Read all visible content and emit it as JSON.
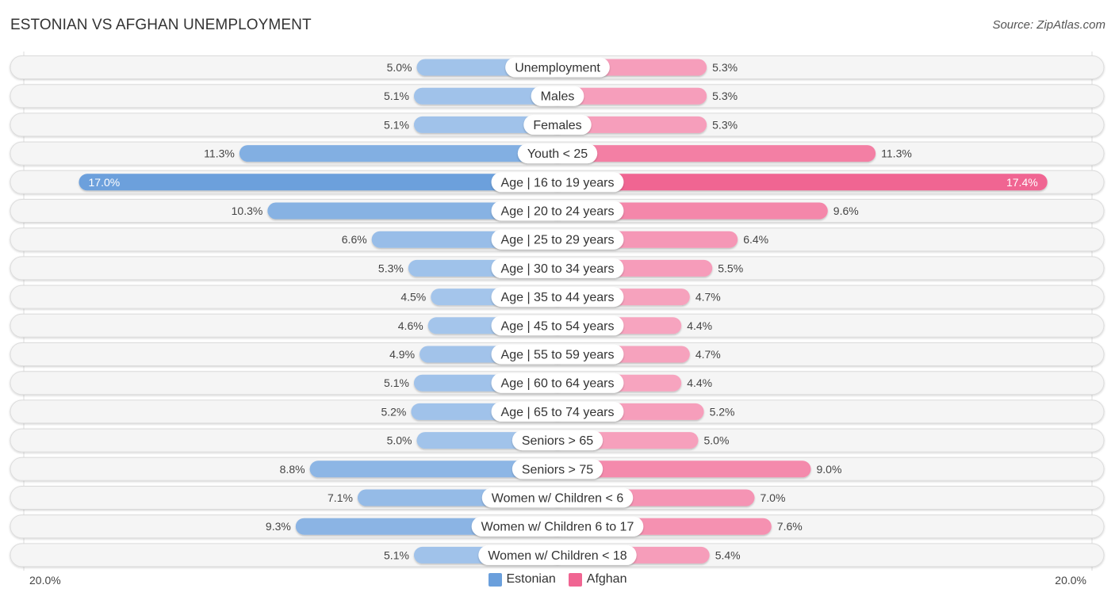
{
  "header": {
    "title": "ESTONIAN VS AFGHAN UNEMPLOYMENT",
    "source": "Source: ZipAtlas.com"
  },
  "chart_data": {
    "type": "bar",
    "orientation": "horizontal-diverging",
    "title": "ESTONIAN VS AFGHAN UNEMPLOYMENT",
    "categories": [
      "Unemployment",
      "Males",
      "Females",
      "Youth < 25",
      "Age | 16 to 19 years",
      "Age | 20 to 24 years",
      "Age | 25 to 29 years",
      "Age | 30 to 34 years",
      "Age | 35 to 44 years",
      "Age | 45 to 54 years",
      "Age | 55 to 59 years",
      "Age | 60 to 64 years",
      "Age | 65 to 74 years",
      "Seniors > 65",
      "Seniors > 75",
      "Women w/ Children < 6",
      "Women w/ Children 6 to 17",
      "Women w/ Children < 18"
    ],
    "series": [
      {
        "name": "Estonian",
        "side": "left",
        "color": "#6a9fdc",
        "values": [
          5.0,
          5.1,
          5.1,
          11.3,
          17.0,
          10.3,
          6.6,
          5.3,
          4.5,
          4.6,
          4.9,
          5.1,
          5.2,
          5.0,
          8.8,
          7.1,
          9.3,
          5.1
        ],
        "labels": [
          "5.0%",
          "5.1%",
          "5.1%",
          "11.3%",
          "17.0%",
          "10.3%",
          "6.6%",
          "5.3%",
          "4.5%",
          "4.6%",
          "4.9%",
          "5.1%",
          "5.2%",
          "5.0%",
          "8.8%",
          "7.1%",
          "9.3%",
          "5.1%"
        ]
      },
      {
        "name": "Afghan",
        "side": "right",
        "color": "#f06592",
        "values": [
          5.3,
          5.3,
          5.3,
          11.3,
          17.4,
          9.6,
          6.4,
          5.5,
          4.7,
          4.4,
          4.7,
          4.4,
          5.2,
          5.0,
          9.0,
          7.0,
          7.6,
          5.4
        ],
        "labels": [
          "5.3%",
          "5.3%",
          "5.3%",
          "11.3%",
          "17.4%",
          "9.6%",
          "6.4%",
          "5.5%",
          "4.7%",
          "4.4%",
          "4.7%",
          "4.4%",
          "5.2%",
          "5.0%",
          "9.0%",
          "7.0%",
          "7.6%",
          "5.4%"
        ]
      }
    ],
    "xlim": [
      -20,
      20
    ],
    "axis_labels": {
      "left": "20.0%",
      "right": "20.0%"
    },
    "legend": {
      "position": "bottom-center",
      "items": [
        "Estonian",
        "Afghan"
      ]
    },
    "grid": false
  },
  "legend": {
    "items": [
      {
        "label": "Estonian",
        "color": "#6a9fdc"
      },
      {
        "label": "Afghan",
        "color": "#f06592"
      }
    ]
  },
  "axis": {
    "left": "20.0%",
    "right": "20.0%"
  }
}
